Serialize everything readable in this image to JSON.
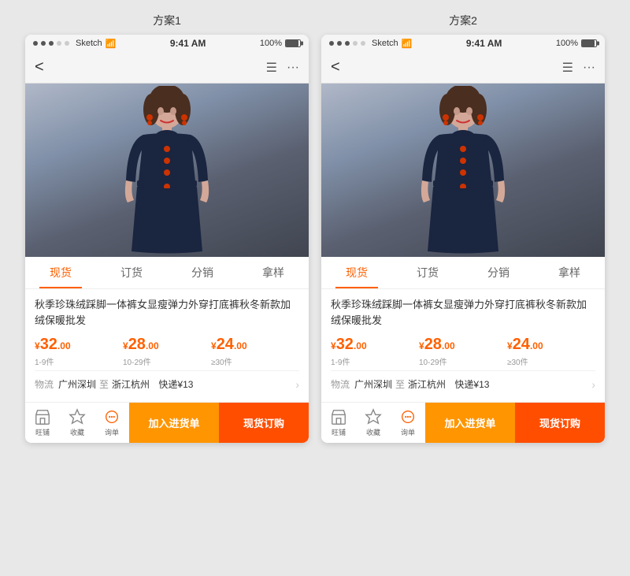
{
  "plans": [
    {
      "id": "plan1",
      "label": "方案1",
      "status_left_dots": [
        "filled",
        "filled",
        "filled",
        "empty",
        "empty"
      ],
      "status_left_text": "Sketch",
      "status_time": "9:41 AM",
      "status_right_text": "100%",
      "nav_back": "<",
      "tabs": [
        "现货",
        "订货",
        "分销",
        "拿样"
      ],
      "active_tab": 0,
      "product_title": "秋季珍珠绒踩脚一体裤女显瘦弹力外穿打底裤秋冬新款加绒保暖批发",
      "prices": [
        {
          "yuan": "¥",
          "int": "32",
          "dec": ".00",
          "range": "1-9件"
        },
        {
          "yuan": "¥",
          "int": "28",
          "dec": ".00",
          "range": "10-29件"
        },
        {
          "yuan": "¥",
          "int": "24",
          "dec": ".00",
          "range": "≥30件"
        }
      ],
      "shipping_label": "物流",
      "shipping_from": "广州深圳",
      "shipping_to_label": "至",
      "shipping_to": "浙江杭州",
      "shipping_method": "快递¥13",
      "bottom_icons": [
        {
          "icon": "store",
          "label": "旺铺"
        },
        {
          "icon": "star",
          "label": "收藏"
        },
        {
          "icon": "chat",
          "label": "询单"
        }
      ],
      "btn_add_cart": "加入进货单",
      "btn_buy_now": "现货订购"
    },
    {
      "id": "plan2",
      "label": "方案2",
      "status_left_dots": [
        "filled",
        "filled",
        "filled",
        "empty",
        "empty"
      ],
      "status_left_text": "Sketch",
      "status_time": "9:41 AM",
      "status_right_text": "100%",
      "nav_back": "<",
      "tabs": [
        "现货",
        "订货",
        "分销",
        "拿样"
      ],
      "active_tab": 0,
      "product_title": "秋季珍珠绒踩脚一体裤女显瘦弹力外穿打底裤秋冬新款加绒保暖批发",
      "prices": [
        {
          "yuan": "¥",
          "int": "32",
          "dec": ".00",
          "range": "1-9件"
        },
        {
          "yuan": "¥",
          "int": "28",
          "dec": ".00",
          "range": "10-29件"
        },
        {
          "yuan": "¥",
          "int": "24",
          "dec": ".00",
          "range": "≥30件"
        }
      ],
      "shipping_label": "物流",
      "shipping_from": "广州深圳",
      "shipping_to_label": "至",
      "shipping_to": "浙江杭州",
      "shipping_method": "快递¥13",
      "bottom_icons": [
        {
          "icon": "store",
          "label": "旺铺"
        },
        {
          "icon": "star",
          "label": "收藏"
        },
        {
          "icon": "chat",
          "label": "询单"
        }
      ],
      "btn_add_cart": "加入进货单",
      "btn_buy_now": "现货订购"
    }
  ]
}
